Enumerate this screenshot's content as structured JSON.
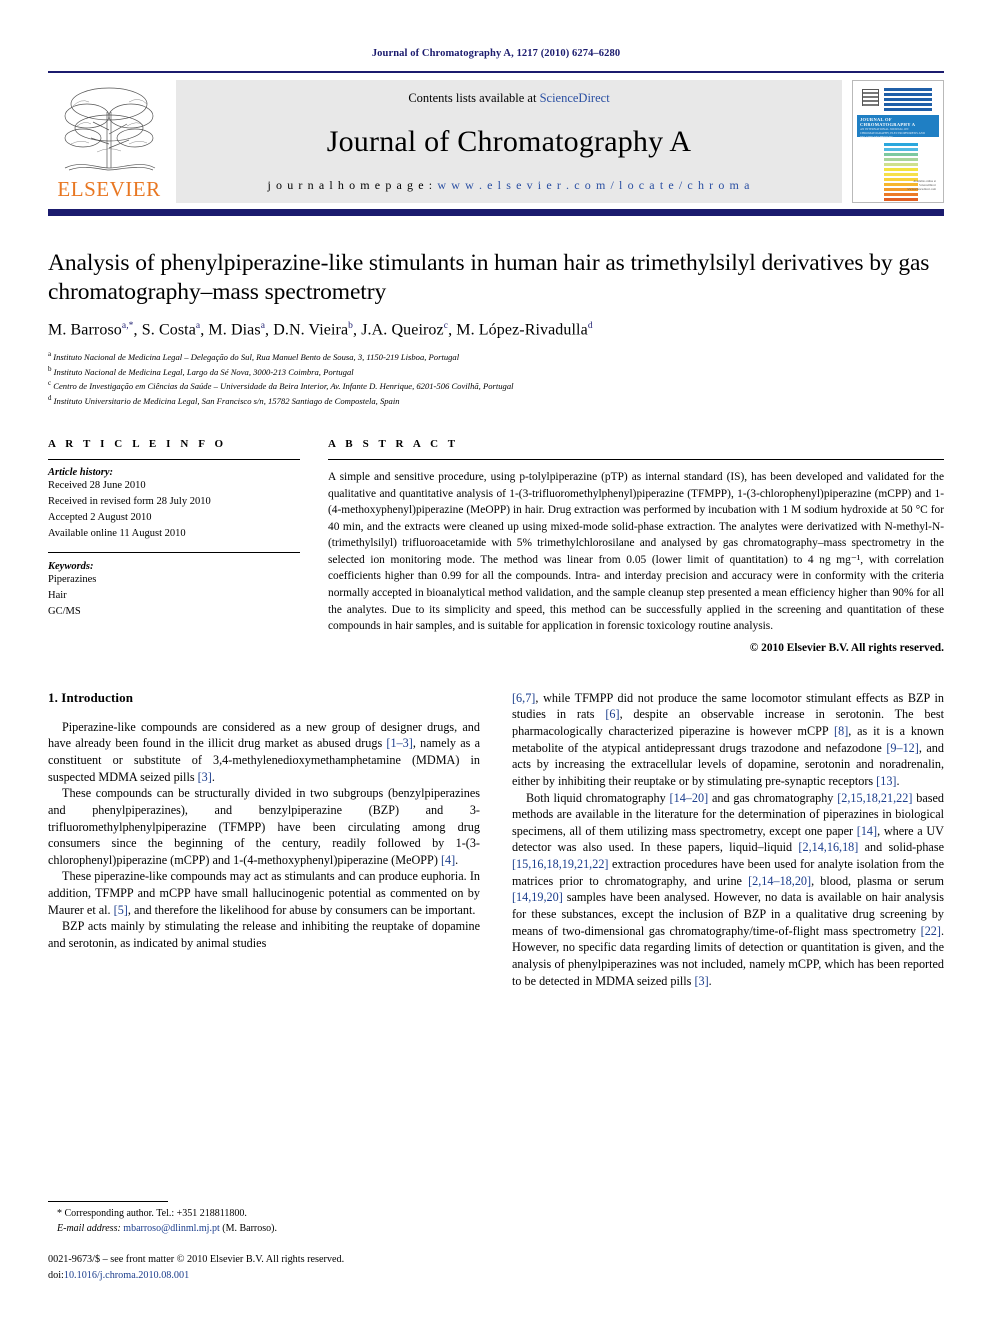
{
  "running_head": "Journal of Chromatography A, 1217 (2010) 6274–6280",
  "masthead": {
    "contents_prefix": "Contents lists available at ",
    "sciencedirect": "ScienceDirect",
    "journal_title": "Journal of Chromatography A",
    "homepage_label": "j o u r n a l   h o m e p a g e :",
    "homepage_url": "w w w . e l s e v i e r . c o m / l o c a t e / c h r o m a",
    "publisher": "ELSEVIER",
    "cover": {
      "band_title": "JOURNAL OF CHROMATOGRAPHY A",
      "band_subtitle": "AN INTERNATIONAL JOURNAL ON CHROMATOGRAPHY, ELECTROPHORESIS AND RELATED TECHNIQUES",
      "sciencedirect_note": "Available online at",
      "sciencedirect_brand": "ScienceDirect",
      "sciencedirect_url": "www.sciencedirect.com"
    },
    "accent_color": "#1b1b6e",
    "link_color": "#2a4fa2",
    "elsevier_orange": "#e87722"
  },
  "article": {
    "title": "Analysis of phenylpiperazine-like stimulants in human hair as trimethylsilyl derivatives by gas chromatography–mass spectrometry",
    "authors_html": "M. Barroso<sup>a,*</sup>, S. Costa<sup>a</sup>, M. Dias<sup>a</sup>, D.N. Vieira<sup>b</sup>, J.A. Queiroz<sup>c</sup>, M. López-Rivadulla<sup>d</sup>",
    "affiliations": [
      {
        "mark": "a",
        "text": "Instituto Nacional de Medicina Legal – Delegação do Sul, Rua Manuel Bento de Sousa, 3, 1150-219 Lisboa, Portugal"
      },
      {
        "mark": "b",
        "text": "Instituto Nacional de Medicina Legal, Largo da Sé Nova, 3000-213 Coimbra, Portugal"
      },
      {
        "mark": "c",
        "text": "Centro de Investigação em Ciências da Saúde – Universidade da Beira Interior, Av. Infante D. Henrique, 6201-506 Covilhã, Portugal"
      },
      {
        "mark": "d",
        "text": "Instituto Universitario de Medicina Legal, San Francisco s/n, 15782 Santiago de Compostela, Spain"
      }
    ]
  },
  "article_info": {
    "heading": "A R T I C L E   I N F O",
    "history_label": "Article history:",
    "history": [
      "Received 28 June 2010",
      "Received in revised form 28 July 2010",
      "Accepted 2 August 2010",
      "Available online 11 August 2010"
    ],
    "keywords_label": "Keywords:",
    "keywords": [
      "Piperazines",
      "Hair",
      "GC/MS"
    ]
  },
  "abstract": {
    "heading": "A B S T R A C T",
    "body": "A simple and sensitive procedure, using p-tolylpiperazine (pTP) as internal standard (IS), has been developed and validated for the qualitative and quantitative analysis of 1-(3-trifluoromethylphenyl)piperazine (TFMPP), 1-(3-chlorophenyl)piperazine (mCPP) and 1-(4-methoxyphenyl)piperazine (MeOPP) in hair. Drug extraction was performed by incubation with 1 M sodium hydroxide at 50 °C for 40 min, and the extracts were cleaned up using mixed-mode solid-phase extraction. The analytes were derivatized with N-methyl-N-(trimethylsilyl) trifluoroacetamide with 5% trimethylchlorosilane and analysed by gas chromatography–mass spectrometry in the selected ion monitoring mode. The method was linear from 0.05 (lower limit of quantitation) to 4 ng mg⁻¹, with correlation coefficients higher than 0.99 for all the compounds. Intra- and interday precision and accuracy were in conformity with the criteria normally accepted in bioanalytical method validation, and the sample cleanup step presented a mean efficiency higher than 90% for all the analytes. Due to its simplicity and speed, this method can be successfully applied in the screening and quantitation of these compounds in hair samples, and is suitable for application in forensic toxicology routine analysis.",
    "copyright": "© 2010 Elsevier B.V. All rights reserved."
  },
  "body": {
    "section_number_title": "1.  Introduction",
    "left_paragraphs": [
      "Piperazine-like compounds are considered as a new group of designer drugs, and have already been found in the illicit drug market as abused drugs [1–3], namely as a constituent or substitute of 3,4-methylenedioxymethamphetamine (MDMA) in suspected MDMA seized pills [3].",
      "These compounds can be structurally divided in two subgroups (benzylpiperazines and phenylpiperazines), and benzylpiperazine (BZP) and 3-trifluoromethylphenylpiperazine (TFMPP) have been circulating among drug consumers since the beginning of the century, readily followed by 1-(3-chlorophenyl)piperazine (mCPP) and 1-(4-methoxyphenyl)piperazine (MeOPP) [4].",
      "These piperazine-like compounds may act as stimulants and can produce euphoria. In addition, TFMPP and mCPP have small hallucinogenic potential as commented on by Maurer et al. [5], and therefore the likelihood for abuse by consumers can be important.",
      "BZP acts mainly by stimulating the release and inhibiting the reuptake of dopamine and serotonin, as indicated by animal studies"
    ],
    "right_paragraphs": [
      "[6,7], while TFMPP did not produce the same locomotor stimulant effects as BZP in studies in rats [6], despite an observable increase in serotonin. The best pharmacologically characterized piperazine is however mCPP [8], as it is a known metabolite of the atypical antidepressant drugs trazodone and nefazodone [9–12], and acts by increasing the extracellular levels of dopamine, serotonin and noradrenalin, either by inhibiting their reuptake or by stimulating pre-synaptic receptors [13].",
      "Both liquid chromatography [14–20] and gas chromatography [2,15,18,21,22] based methods are available in the literature for the determination of piperazines in biological specimens, all of them utilizing mass spectrometry, except one paper [14], where a UV detector was also used. In these papers, liquid–liquid [2,14,16,18] and solid-phase [15,16,18,19,21,22] extraction procedures have been used for analyte isolation from the matrices prior to chromatography, and urine [2,14–18,20], blood, plasma or serum [14,19,20] samples have been analysed. However, no data is available on hair analysis for these substances, except the inclusion of BZP in a qualitative drug screening by means of two-dimensional gas chromatography/time-of-flight mass spectrometry [22]. However, no specific data regarding limits of detection or quantitation is given, and the analysis of phenylpiperazines was not included, namely mCPP, which has been reported to be detected in MDMA seized pills [3]."
    ]
  },
  "footnotes": {
    "corresponding": "* Corresponding author. Tel.: +351 218811800.",
    "email_label": "E-mail address:",
    "email": "mbarroso@dlinml.mj.pt",
    "email_suffix": "(M. Barroso).",
    "issn_line": "0021-9673/$ – see front matter © 2010 Elsevier B.V. All rights reserved.",
    "doi_label": "doi:",
    "doi": "10.1016/j.chroma.2010.08.001"
  }
}
